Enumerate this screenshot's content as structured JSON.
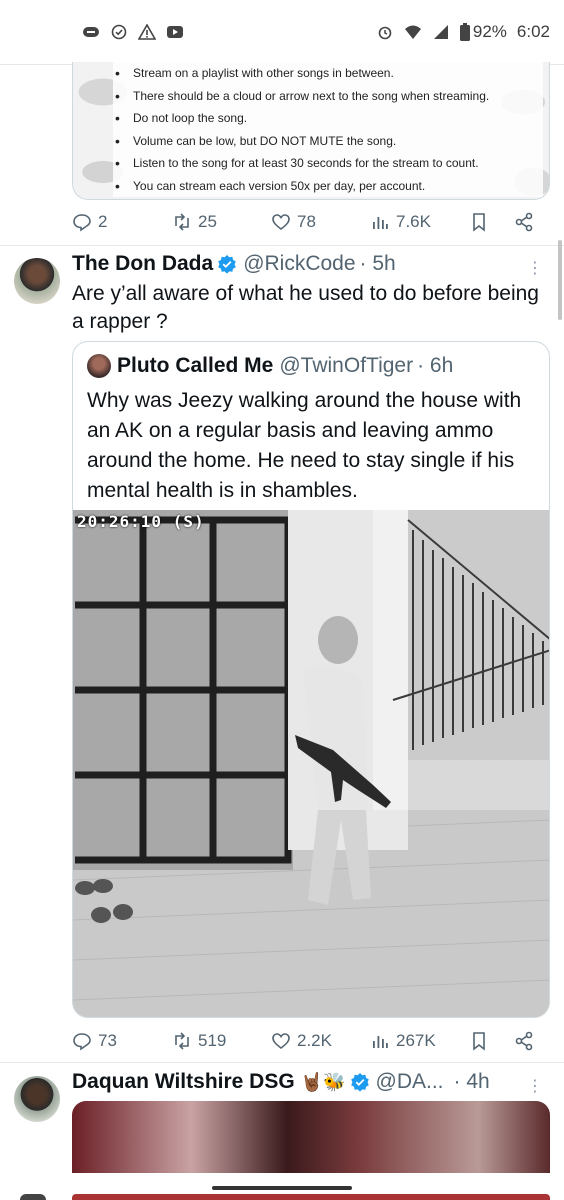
{
  "status_bar": {
    "battery": "92%",
    "time": "6:02",
    "left_icons": [
      "cloud-chat-icon",
      "check-circle-icon",
      "warning-icon",
      "youtube-icon"
    ],
    "right_icons": [
      "alarm-icon",
      "wifi-icon",
      "signal-icon",
      "battery-icon"
    ]
  },
  "top_tweet": {
    "image_rules": [
      "Stream on a playlist with other songs in between.",
      "There should be a cloud or arrow next to the song when streaming.",
      "Do not loop the song.",
      "Volume can be low, but DO NOT MUTE the song.",
      "Listen to the song for at least 30 seconds for the stream to count.",
      "You can stream each version 50x per day, per account."
    ],
    "actions": {
      "replies": "2",
      "retweets": "25",
      "likes": "78",
      "views": "7.6K"
    }
  },
  "tweet": {
    "name": "The Don Dada",
    "handle": "@RickCode",
    "time": "· 5h",
    "text": "Are y’all aware of what he used to do before being a rapper ?",
    "quote": {
      "name": "Pluto Called Me",
      "handle": "@TwinOfTiger",
      "time": "· 6h",
      "text": "Why was Jeezy walking around the house with an AK on a regular basis and leaving ammo around the home. He need to stay single if his mental health is in shambles.",
      "video_timestamp": "20:26:10 (S)"
    },
    "actions": {
      "replies": "73",
      "retweets": "519",
      "likes": "2.2K",
      "views": "267K"
    }
  },
  "next_tweet": {
    "name": "Daquan Wiltshire DSG",
    "handle": "@DA...",
    "time": "· 4h",
    "emoji": "🤘🏾🐝"
  },
  "colors": {
    "accent": "#1d9bf0",
    "secondary_text": "#536471",
    "border": "#cfd9de"
  }
}
